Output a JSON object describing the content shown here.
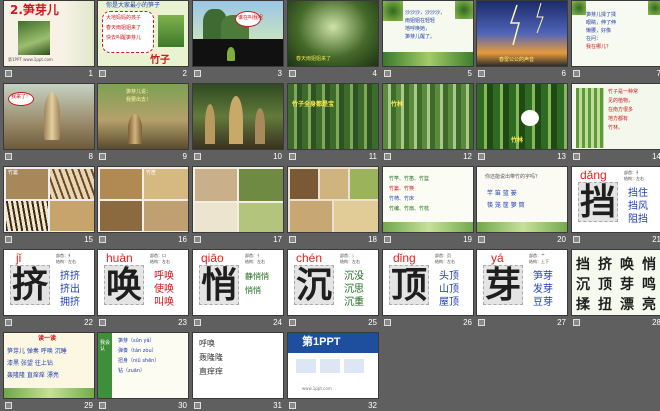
{
  "window": {
    "title": "笋芽儿 slide sorter"
  },
  "slides": [
    {
      "n": "1",
      "title": "2.笋芽儿",
      "subtitle": "第1PPT  www.1ppt.com"
    },
    {
      "n": "2",
      "head": "你是大家最小的笋子",
      "lines": [
        "大地妈妈的孩子",
        "春天雨姐姐来了",
        "快去叫醒笋芽儿"
      ],
      "answer": "竹子"
    },
    {
      "n": "3",
      "bubble": "谁在叫我呢"
    },
    {
      "n": "4",
      "caption": "春天雨姐姐来了"
    },
    {
      "n": "5",
      "lines": [
        "沙沙沙，沙沙沙，",
        "雨姐姐在轻轻",
        "地呼唤她，",
        "笋芽儿醒了。"
      ]
    },
    {
      "n": "6",
      "caption": "春雷公公的声音"
    },
    {
      "n": "7",
      "lines": [
        "笋芽儿揉了揉",
        "眼睛，伸了伸",
        "懒腰，好像",
        "在问：",
        "我在哪儿？"
      ]
    },
    {
      "n": "8",
      "bubble": "我来了!"
    },
    {
      "n": "9",
      "lines": [
        "笋芽儿说：",
        "我要出去！"
      ]
    },
    {
      "n": "10"
    },
    {
      "n": "11",
      "caption": "竹子全身都是宝"
    },
    {
      "n": "12",
      "caption": "竹林"
    },
    {
      "n": "13",
      "caption": "竹林"
    },
    {
      "n": "14",
      "lines": [
        "竹子是一种常",
        "见的植物，",
        "在南方很多",
        "地方都有",
        "竹林。"
      ]
    },
    {
      "n": "15",
      "caption": "竹篓"
    },
    {
      "n": "16",
      "caption": "竹筐"
    },
    {
      "n": "17"
    },
    {
      "n": "18"
    },
    {
      "n": "19",
      "lines": [
        "竹竿、竹笛、竹篮",
        "竹篓、竹筷",
        "竹椅、竹床",
        "竹编、竹扇、竹枕"
      ]
    },
    {
      "n": "20",
      "head": "你还能说出带竹的字吗？",
      "lines": [
        "竿 笛 篮 篓",
        "筷 笼 筐 箩 筒"
      ]
    },
    {
      "n": "21",
      "pinyin": "dǎng",
      "char": "挡",
      "words": [
        "挡住",
        "挡风",
        "阻挡"
      ],
      "info": [
        "部首：扌",
        "结构：左右"
      ]
    },
    {
      "n": "22",
      "pinyin": "jǐ",
      "char": "挤",
      "words": [
        "挤挤",
        "挤出",
        "拥挤"
      ],
      "info": [
        "部首：扌",
        "结构：左右"
      ]
    },
    {
      "n": "23",
      "pinyin": "huàn",
      "char": "唤",
      "words": [
        "呼唤",
        "使唤",
        "叫唤"
      ],
      "info": [
        "部首：口",
        "结构：左右"
      ]
    },
    {
      "n": "24",
      "pinyin": "qiāo",
      "char": "悄",
      "words": [
        "静悄悄",
        "悄悄"
      ],
      "info": [
        "部首：忄",
        "结构：左右"
      ]
    },
    {
      "n": "25",
      "pinyin": "chén",
      "char": "沉",
      "words": [
        "沉没",
        "沉思",
        "沉重"
      ],
      "info": [
        "部首：氵",
        "结构：左右"
      ]
    },
    {
      "n": "26",
      "pinyin": "dǐng",
      "char": "顶",
      "words": [
        "头顶",
        "山顶",
        "屋顶"
      ],
      "info": [
        "部首：页",
        "结构：左右"
      ]
    },
    {
      "n": "27",
      "pinyin": "yá",
      "char": "芽",
      "words": [
        "笋芽",
        "发芽",
        "豆芽"
      ],
      "info": [
        "部首：艹",
        "结构：上下"
      ]
    },
    {
      "n": "28",
      "chars": [
        [
          "挡",
          "挤",
          "唤",
          "悄"
        ],
        [
          "沉",
          "顶",
          "芽",
          "鸣"
        ],
        [
          "揉",
          "扭",
          "漂",
          "亮"
        ]
      ]
    },
    {
      "n": "29",
      "head": "读一读",
      "lines": [
        "笋芽儿 弹奏 呼唤 沉睡",
        "漆黑 张望 往上钻",
        "轰隆隆 直痒痒 漂亮"
      ]
    },
    {
      "n": "30",
      "lines": [
        "笋芽（sǔn yá）",
        "弹奏（tán zòu）",
        "扭身（niǔ shēn）",
        "钻（zuān）"
      ],
      "side": "我会认"
    },
    {
      "n": "31",
      "lines": [
        "呼唤",
        "轰隆隆",
        "直痒痒"
      ]
    },
    {
      "n": "32",
      "brand": "第1PPT",
      "url": "www.1ppt.com"
    }
  ],
  "colors": {
    "background": "#5f5f5f",
    "accent_red": "#d4161c",
    "accent_green": "#1f6b1f",
    "accent_blue": "#1f3fb5"
  }
}
